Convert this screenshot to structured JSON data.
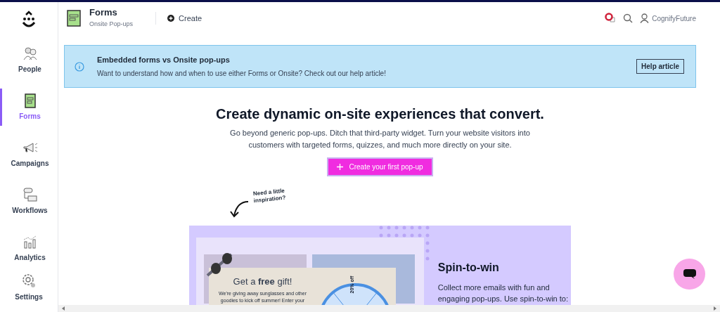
{
  "sidebar": {
    "items": [
      {
        "label": "People",
        "selected": false
      },
      {
        "label": "Forms",
        "selected": true
      },
      {
        "label": "Campaigns",
        "selected": false
      },
      {
        "label": "Workflows",
        "selected": false
      },
      {
        "label": "Analytics",
        "selected": false
      }
    ],
    "footer": {
      "label": "Settings"
    }
  },
  "header": {
    "title": "Forms",
    "subtitle": "Onsite Pop-ups",
    "create": "Create",
    "user": "CognifyFuture"
  },
  "banner": {
    "title": "Embedded forms vs Onsite pop-ups",
    "text": "Want to understand how and when to use either Forms or Onsite? Check out our help article!",
    "button": "Help article"
  },
  "hero": {
    "title": "Create dynamic on-site experiences that convert.",
    "text": "Go beyond generic pop-ups. Ditch that third-party widget. Turn your website visitors into customers with targeted forms, quizzes, and much more directly on your site.",
    "button": "Create your first pop-up"
  },
  "annotation": "Need a little inspiration?",
  "showcase": {
    "popup_title": "Get a **free** gift!",
    "popup_text": "We're giving away sunglasses and other goodies to kick off summer! Enter your",
    "wheel_label": "20% off",
    "title": "Spin-to-win",
    "text": "Collect more emails with fun and engaging pop-ups. Use spin-to-win to:"
  }
}
